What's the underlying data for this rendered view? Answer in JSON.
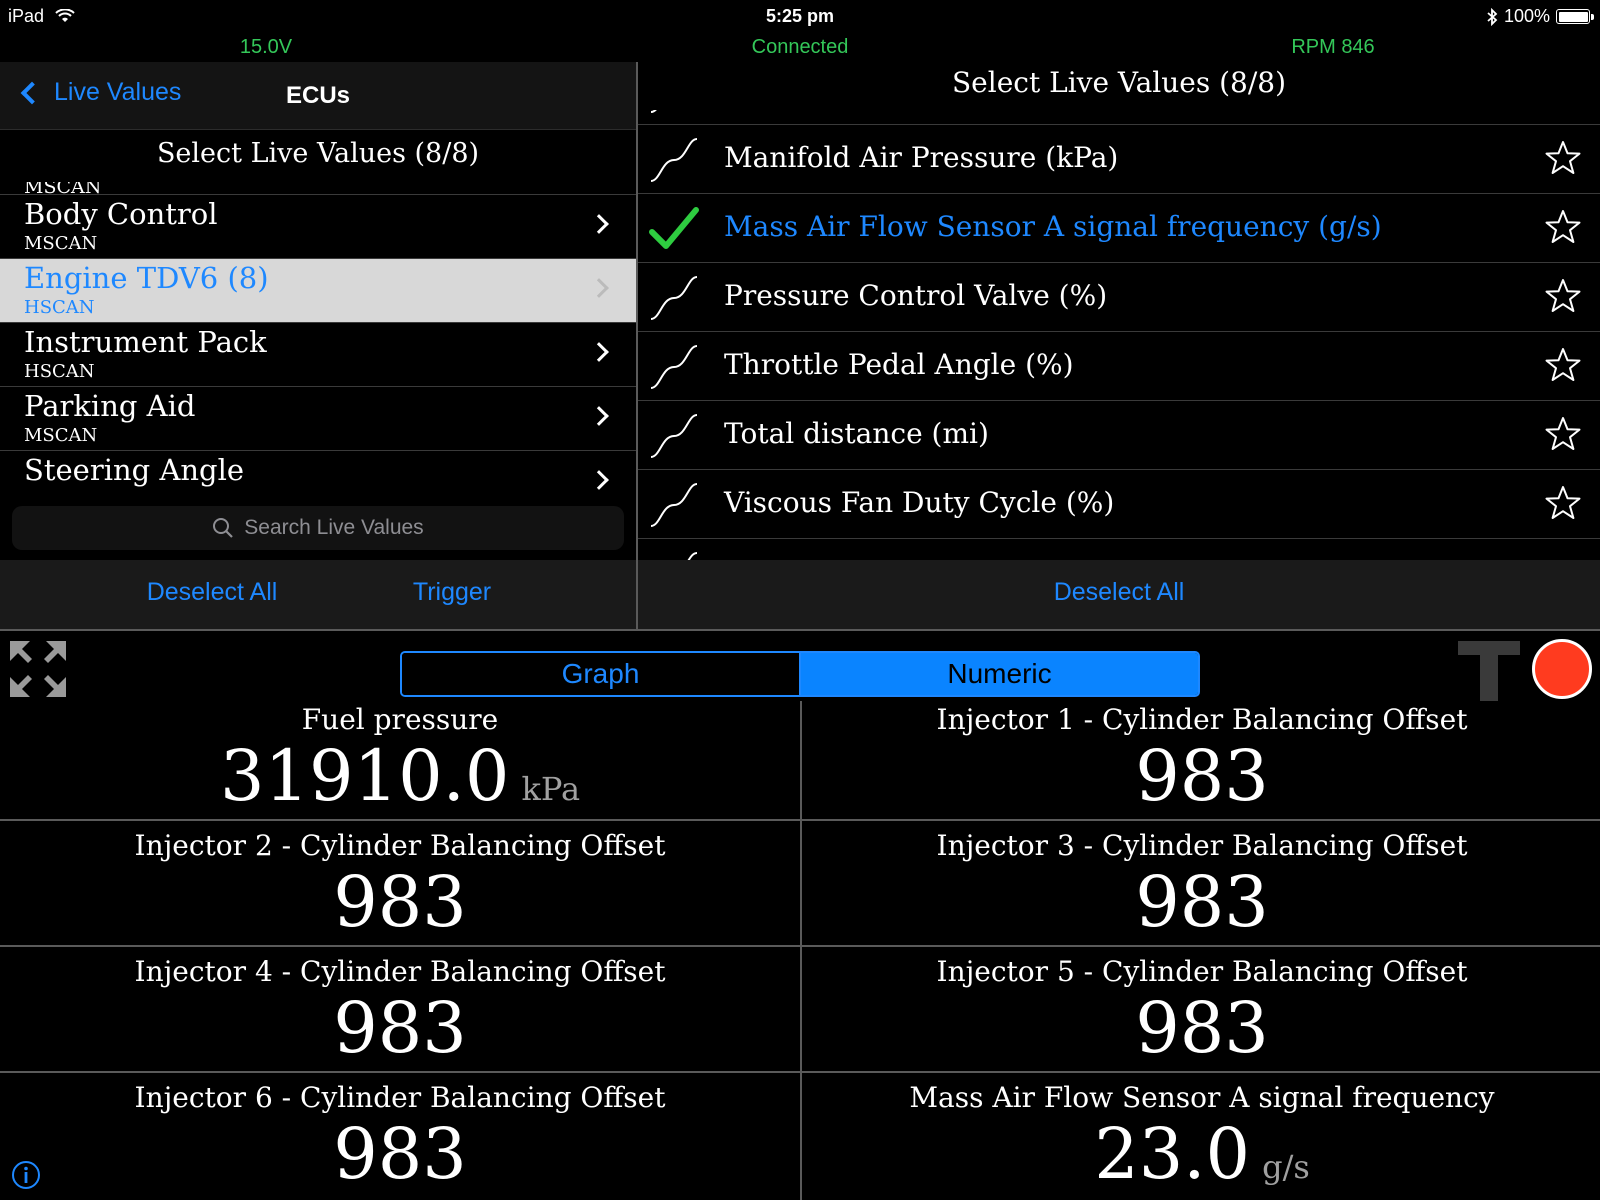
{
  "status": {
    "carrier": "iPad",
    "time": "5:25 pm",
    "battery": "100%",
    "battery_level": 1.0
  },
  "info": {
    "voltage": "15.0V",
    "connection": "Connected",
    "rpm": "RPM 846"
  },
  "left": {
    "back_label": "Live Values",
    "title": "ECUs",
    "section_header": "Select Live Values (8/8)",
    "clipped_bus": "MSCAN",
    "ecus": [
      {
        "name": "Body Control",
        "bus": "MSCAN",
        "selected": false
      },
      {
        "name": "Engine TDV6 (8)",
        "bus": "HSCAN",
        "selected": true
      },
      {
        "name": "Instrument Pack",
        "bus": "HSCAN",
        "selected": false
      },
      {
        "name": "Parking Aid",
        "bus": "MSCAN",
        "selected": false
      },
      {
        "name": "Steering Angle",
        "bus": "",
        "selected": false
      }
    ],
    "search_placeholder": "Search Live Values",
    "deselect_all": "Deselect All",
    "trigger": "Trigger"
  },
  "right": {
    "title": "Select Live Values (8/8)",
    "items": [
      {
        "label": "Manifold Air Pressure (kPa)",
        "selected": false
      },
      {
        "label": "Mass Air Flow Sensor A signal frequency (g/s)",
        "selected": true
      },
      {
        "label": "Pressure Control Valve (%)",
        "selected": false
      },
      {
        "label": "Throttle Pedal Angle (%)",
        "selected": false
      },
      {
        "label": "Total distance (mi)",
        "selected": false
      },
      {
        "label": "Viscous Fan Duty Cycle (%)",
        "selected": false
      }
    ],
    "deselect_all": "Deselect All"
  },
  "bottom": {
    "segments": {
      "graph": "Graph",
      "numeric": "Numeric",
      "active": "numeric"
    },
    "readings": [
      {
        "title": "Fuel pressure",
        "value": "31910.0",
        "unit": "kPa"
      },
      {
        "title": "Injector 1 - Cylinder Balancing Offset",
        "value": "983",
        "unit": ""
      },
      {
        "title": "Injector 2 - Cylinder Balancing Offset",
        "value": "983",
        "unit": ""
      },
      {
        "title": "Injector 3 - Cylinder Balancing Offset",
        "value": "983",
        "unit": ""
      },
      {
        "title": "Injector 4 - Cylinder Balancing Offset",
        "value": "983",
        "unit": ""
      },
      {
        "title": "Injector 5 - Cylinder Balancing Offset",
        "value": "983",
        "unit": ""
      },
      {
        "title": "Injector 6 - Cylinder Balancing Offset",
        "value": "983",
        "unit": ""
      },
      {
        "title": "Mass Air Flow Sensor A signal frequency",
        "value": "23.0",
        "unit": "g/s"
      }
    ]
  },
  "colors": {
    "accent": "#1e88ff",
    "green": "#34c759",
    "record": "#ff3b1f",
    "selected_row": "#d8d8d8"
  },
  "icons": [
    "wifi-icon",
    "bluetooth-icon",
    "battery-icon",
    "back-chevron-icon",
    "chevron-right-icon",
    "search-icon",
    "sine-wave-icon",
    "checkmark-icon",
    "star-icon",
    "expand-icon",
    "trigger-t-icon",
    "record-icon",
    "info-icon"
  ]
}
